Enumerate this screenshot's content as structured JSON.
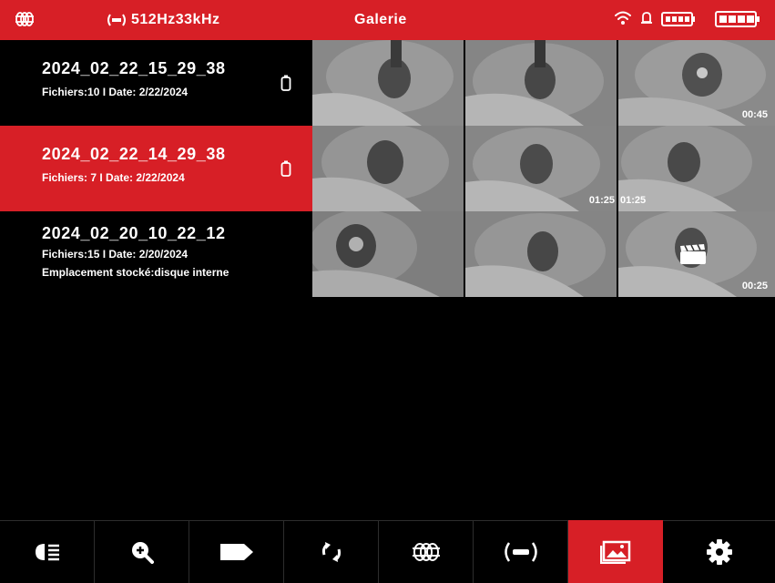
{
  "status_bar": {
    "frequency": "512Hz33kHz",
    "title": "Galerie",
    "icons": [
      "sonde-grid-icon",
      "frequency-transmitter-icon",
      "wifi-icon",
      "bell-icon",
      "battery-icon",
      "battery-full-icon"
    ]
  },
  "colors": {
    "accent": "#d71f26",
    "background": "#000000"
  },
  "folders": [
    {
      "name": "2024_02_22_15_29_38",
      "meta": "Fichiers:10  I  Date: 2/22/2024",
      "location": "",
      "selected": false,
      "thumbnails": [
        {
          "duration": ""
        },
        {
          "duration": ""
        },
        {
          "duration": "00:45"
        }
      ]
    },
    {
      "name": "2024_02_22_14_29_38",
      "meta": "Fichiers: 7  I  Date: 2/22/2024",
      "location": "",
      "selected": true,
      "thumbnails": [
        {
          "duration": ""
        },
        {
          "duration": "01:25"
        },
        {
          "duration": "01:25"
        }
      ]
    },
    {
      "name": "2024_02_20_10_22_12",
      "meta": "Fichiers:15  I  Date: 2/20/2024",
      "location": "Emplacement stocké:disque interne",
      "selected": false,
      "thumbnails": [
        {
          "duration": ""
        },
        {
          "duration": ""
        },
        {
          "duration": "00:25"
        }
      ]
    }
  ],
  "toolbar": {
    "items": [
      {
        "icon": "headlight-icon"
      },
      {
        "icon": "zoom-in-icon"
      },
      {
        "icon": "tag-icon"
      },
      {
        "icon": "rotate-icon"
      },
      {
        "icon": "sonde-grid-icon"
      },
      {
        "icon": "transmitter-icon"
      },
      {
        "icon": "gallery-icon",
        "active": true
      },
      {
        "icon": "settings-gear-icon"
      }
    ]
  }
}
